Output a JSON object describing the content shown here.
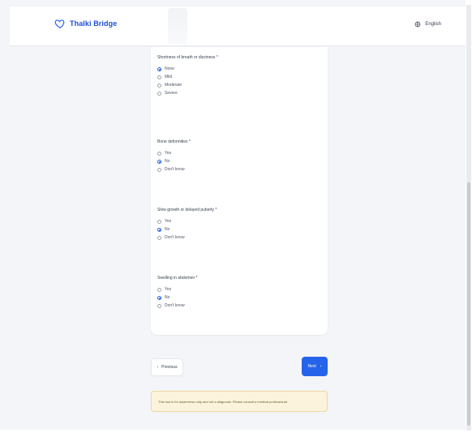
{
  "header": {
    "brand": "Thalki Bridge",
    "language": "English"
  },
  "questions": [
    {
      "title": "Shortness of breath or dizziness *",
      "options": [
        "None",
        "Mild",
        "Moderate",
        "Severe"
      ],
      "selected": 0
    },
    {
      "title": "Bone deformities *",
      "options": [
        "Yes",
        "No",
        "Don't know"
      ],
      "selected": 1
    },
    {
      "title": "Slow growth or delayed puberty *",
      "options": [
        "Yes",
        "No",
        "Don't know"
      ],
      "selected": 1
    },
    {
      "title": "Swelling in abdomen *",
      "options": [
        "Yes",
        "No",
        "Don't know"
      ],
      "selected": 1
    }
  ],
  "navigation": {
    "previous_label": "Previous",
    "next_label": "Next"
  },
  "notice": {
    "text": "This tool is for awareness only and not a diagnosis. Please consult a medical professional."
  },
  "colors": {
    "accent": "#2563eb",
    "notice_bg": "#fbf3dc"
  }
}
